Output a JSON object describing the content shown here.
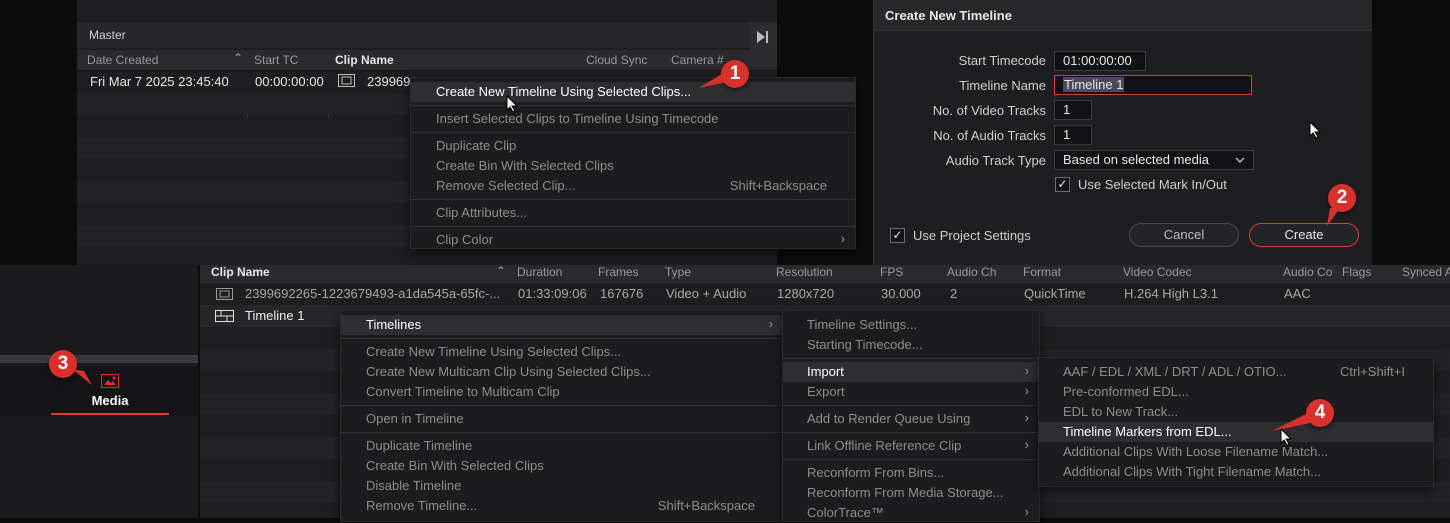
{
  "top_pool": {
    "bin_name": "Master",
    "columns": [
      "Date Created",
      "Start TC",
      "Clip Name",
      "Cloud Sync",
      "Camera #"
    ],
    "row": {
      "date_created": "Fri Mar 7 2025 23:45:40",
      "start_tc": "00:00:00:00",
      "clip_name": "239969"
    }
  },
  "context_menu_1": {
    "items": [
      {
        "label": "Create New Timeline Using Selected Clips...",
        "shortcut": ""
      },
      {
        "label": "Insert Selected Clips to Timeline Using Timecode",
        "shortcut": ""
      },
      {
        "label": "Duplicate Clip",
        "shortcut": ""
      },
      {
        "label": "Create Bin With Selected Clips",
        "shortcut": ""
      },
      {
        "label": "Remove Selected Clip...",
        "shortcut": "Shift+Backspace"
      },
      {
        "label": "Clip Attributes...",
        "shortcut": ""
      },
      {
        "label": "Clip Color",
        "shortcut": ""
      }
    ]
  },
  "dialog": {
    "title": "Create New Timeline",
    "start_timecode_label": "Start Timecode",
    "start_timecode_value": "01:00:00:00",
    "timeline_name_label": "Timeline Name",
    "timeline_name_value": "Timeline 1",
    "video_tracks_label": "No. of Video Tracks",
    "video_tracks_value": "1",
    "audio_tracks_label": "No. of Audio Tracks",
    "audio_tracks_value": "1",
    "audio_track_type_label": "Audio Track Type",
    "audio_track_type_value": "Based on selected media",
    "use_mark_label": "Use Selected Mark In/Out",
    "use_project_settings_label": "Use Project Settings",
    "cancel_label": "Cancel",
    "create_label": "Create"
  },
  "bottom_pool": {
    "columns": [
      "Clip Name",
      "Duration",
      "Frames",
      "Type",
      "Resolution",
      "FPS",
      "Audio Ch",
      "Format",
      "Video Codec",
      "Audio Co",
      "Flags",
      "Synced A"
    ],
    "clip_row": {
      "clip_name": "2399692265-1223679493-a1da545a-65fc-...",
      "duration": "01:33:09:06",
      "frames": "167676",
      "type": "Video + Audio",
      "resolution": "1280x720",
      "fps": "30.000",
      "audio_ch": "2",
      "format": "QuickTime",
      "video_codec": "H.264 High L3.1",
      "audio_codec": "AAC"
    },
    "timeline_row": {
      "clip_name": "Timeline 1"
    }
  },
  "media_tab": {
    "label": "Media"
  },
  "context_menu_2": {
    "items": [
      {
        "label": "Timelines",
        "shortcut": ""
      },
      {
        "label": "Create New Timeline Using Selected Clips...",
        "shortcut": ""
      },
      {
        "label": "Create New Multicam Clip Using Selected Clips...",
        "shortcut": ""
      },
      {
        "label": "Convert Timeline to Multicam Clip",
        "shortcut": ""
      },
      {
        "label": "Open in Timeline",
        "shortcut": ""
      },
      {
        "label": "Duplicate Timeline",
        "shortcut": ""
      },
      {
        "label": "Create Bin With Selected Clips",
        "shortcut": ""
      },
      {
        "label": "Disable Timeline",
        "shortcut": ""
      },
      {
        "label": "Remove Timeline...",
        "shortcut": "Shift+Backspace"
      }
    ]
  },
  "context_menu_3": {
    "items": [
      {
        "label": "Timeline Settings..."
      },
      {
        "label": "Starting Timecode..."
      },
      {
        "label": "Import"
      },
      {
        "label": "Export"
      },
      {
        "label": "Add to Render Queue Using"
      },
      {
        "label": "Link Offline Reference Clip"
      },
      {
        "label": "Reconform From Bins..."
      },
      {
        "label": "Reconform From Media Storage..."
      },
      {
        "label": "ColorTrace™"
      }
    ]
  },
  "context_menu_4": {
    "items": [
      {
        "label": "AAF / EDL / XML / DRT / ADL / OTIO...",
        "shortcut": "Ctrl+Shift+I"
      },
      {
        "label": "Pre-conformed EDL...",
        "shortcut": ""
      },
      {
        "label": "EDL to New Track...",
        "shortcut": ""
      },
      {
        "label": "Timeline Markers from EDL...",
        "shortcut": ""
      },
      {
        "label": "Additional Clips With Loose Filename Match...",
        "shortcut": ""
      },
      {
        "label": "Additional Clips With Tight Filename Match...",
        "shortcut": ""
      }
    ]
  },
  "badges": [
    "1",
    "2",
    "3",
    "4"
  ],
  "colors": {
    "accent_red": "#d8302a",
    "highlight_border": "#e03c31"
  }
}
